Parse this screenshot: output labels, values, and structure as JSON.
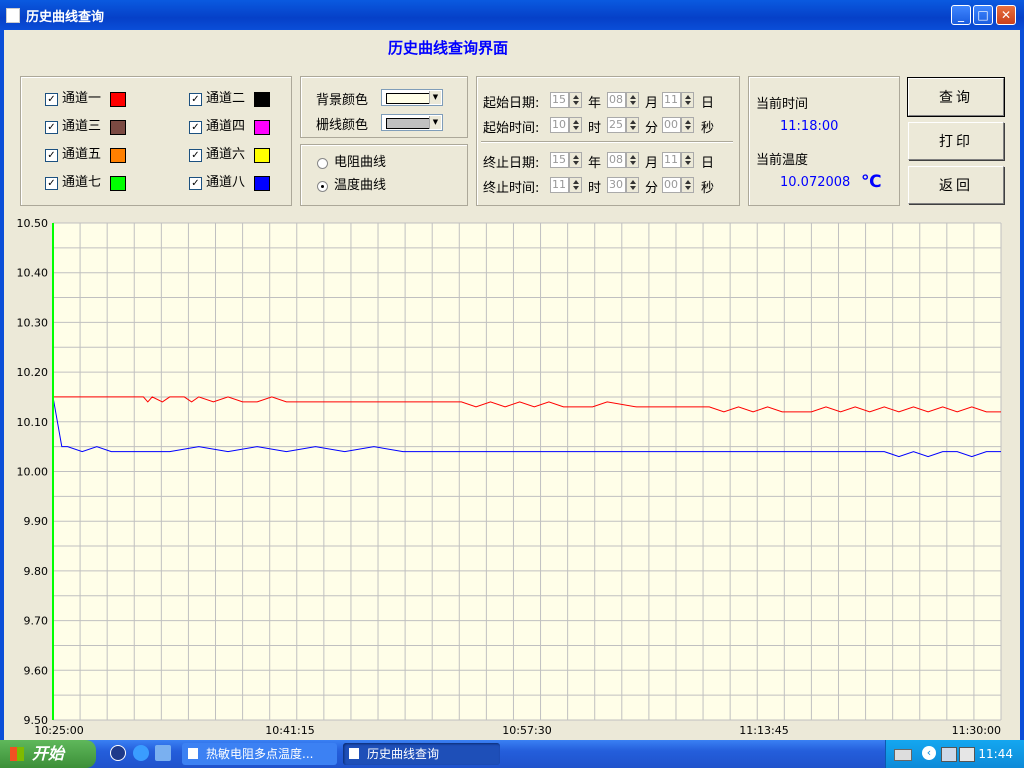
{
  "window": {
    "title": "历史曲线查询",
    "heading": "历史曲线查询界面"
  },
  "channels": [
    {
      "label": "通道一",
      "checked": true,
      "color": "#ff0000"
    },
    {
      "label": "通道二",
      "checked": true,
      "color": "#000000"
    },
    {
      "label": "通道三",
      "checked": true,
      "color": "#7b4a42"
    },
    {
      "label": "通道四",
      "checked": true,
      "color": "#ff00ff"
    },
    {
      "label": "通道五",
      "checked": true,
      "color": "#ff8000"
    },
    {
      "label": "通道六",
      "checked": true,
      "color": "#ffff00"
    },
    {
      "label": "通道七",
      "checked": true,
      "color": "#00ff00"
    },
    {
      "label": "通道八",
      "checked": true,
      "color": "#0000ff"
    }
  ],
  "colors": {
    "bg_label": "背景颜色",
    "bg_color": "#fffee8",
    "grid_label": "栅线颜色",
    "grid_color": "#c0c0c0"
  },
  "curve_type": {
    "options": [
      "电阻曲线",
      "温度曲线"
    ],
    "selected": "温度曲线"
  },
  "query": {
    "start_date_label": "起始日期:",
    "start_time_label": "起始时间:",
    "end_date_label": "终止日期:",
    "end_time_label": "终止时间:",
    "start_date": {
      "year": "15",
      "month": "08",
      "day": "11"
    },
    "start_time": {
      "hour": "10",
      "minute": "25",
      "second": "00"
    },
    "end_date": {
      "year": "15",
      "month": "08",
      "day": "11"
    },
    "end_time": {
      "hour": "11",
      "minute": "30",
      "second": "00"
    },
    "units": {
      "year": "年",
      "month": "月",
      "day": "日",
      "hour": "时",
      "minute": "分",
      "second": "秒"
    }
  },
  "status": {
    "current_time_label": "当前时间",
    "current_time": "11:18:00",
    "current_temp_label": "当前温度",
    "current_temp": "10.072008",
    "temp_unit": "℃"
  },
  "buttons": {
    "query": "查询",
    "print": "打印",
    "back": "返回"
  },
  "chart_data": {
    "type": "line",
    "background": "#fffee8",
    "grid_color": "#c0c0c0",
    "ylim": [
      9.5,
      10.5
    ],
    "y_ticks": [
      "10.50",
      "10.40",
      "10.30",
      "10.20",
      "10.10",
      "10.00",
      "9.90",
      "9.80",
      "9.70",
      "9.60",
      "9.50"
    ],
    "x_tick_labels": [
      "10:25:00",
      "10:41:15",
      "10:57:30",
      "11:13:45",
      "11:30:00"
    ],
    "xlim_minutes": [
      0,
      65
    ],
    "series": [
      {
        "color": "#ff0000",
        "x": [
          0,
          6.2,
          6.5,
          6.8,
          7.5,
          8.0,
          9.0,
          9.5,
          10,
          11,
          12,
          13,
          14,
          15,
          16,
          17,
          20,
          25,
          28,
          29,
          30,
          31,
          32,
          33,
          34,
          35,
          37,
          38,
          40,
          43,
          44,
          45,
          46,
          47,
          48,
          49,
          50,
          51,
          52,
          53,
          54,
          55,
          56,
          57,
          58,
          59,
          60,
          61,
          62,
          63,
          64,
          65
        ],
        "y": [
          10.15,
          10.15,
          10.14,
          10.15,
          10.14,
          10.15,
          10.15,
          10.14,
          10.15,
          10.14,
          10.15,
          10.14,
          10.14,
          10.15,
          10.14,
          10.14,
          10.14,
          10.14,
          10.14,
          10.13,
          10.14,
          10.13,
          10.14,
          10.13,
          10.14,
          10.13,
          10.13,
          10.14,
          10.13,
          10.13,
          10.13,
          10.13,
          10.12,
          10.13,
          10.12,
          10.13,
          10.12,
          10.12,
          10.12,
          10.13,
          10.12,
          10.13,
          10.12,
          10.13,
          10.12,
          10.13,
          10.12,
          10.13,
          10.12,
          10.13,
          10.12,
          10.12
        ]
      },
      {
        "color": "#0000ff",
        "x": [
          0,
          0.3,
          0.6,
          1,
          2,
          3,
          4,
          5,
          8,
          10,
          12,
          14,
          16,
          18,
          20,
          22,
          24,
          26,
          30,
          35,
          40,
          45,
          48,
          50,
          52,
          55,
          57,
          58,
          59,
          60,
          61,
          62,
          63,
          64,
          65
        ],
        "y": [
          10.15,
          10.1,
          10.05,
          10.05,
          10.04,
          10.05,
          10.04,
          10.04,
          10.04,
          10.05,
          10.04,
          10.05,
          10.04,
          10.05,
          10.04,
          10.05,
          10.04,
          10.04,
          10.04,
          10.04,
          10.04,
          10.04,
          10.04,
          10.04,
          10.04,
          10.04,
          10.04,
          10.03,
          10.04,
          10.03,
          10.04,
          10.04,
          10.03,
          10.04,
          10.04
        ]
      },
      {
        "color": "#00ff00",
        "x": [
          0,
          0
        ],
        "y": [
          9.5,
          10.5
        ]
      }
    ]
  },
  "taskbar": {
    "start_label": "开始",
    "tasks": [
      {
        "label": "热敏电阻多点温度..."
      },
      {
        "label": "历史曲线查询"
      }
    ],
    "clock": "11:44"
  }
}
